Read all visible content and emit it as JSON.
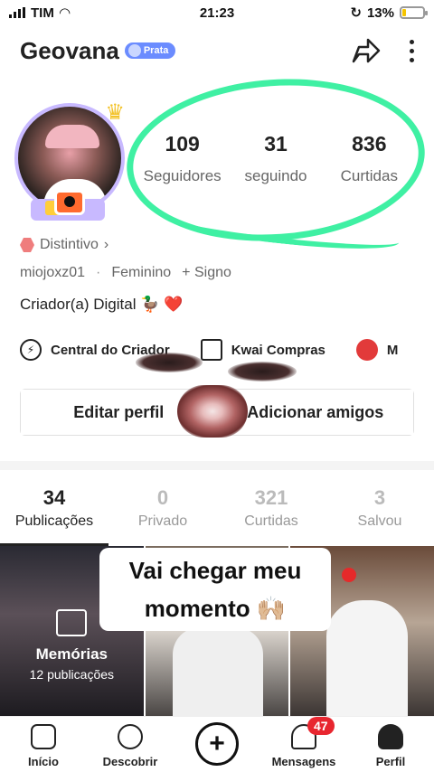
{
  "status_bar": {
    "carrier": "TIM",
    "time": "21:23",
    "battery": "13%"
  },
  "header": {
    "username": "Geovana",
    "badge": "Prata"
  },
  "stats": [
    {
      "value": "109",
      "label": "Seguidores"
    },
    {
      "value": "31",
      "label": "seguindo"
    },
    {
      "value": "836",
      "label": "Curtidas"
    }
  ],
  "profile": {
    "distintivo": "Distintivo",
    "handle": "miojoxz01",
    "gender": "Feminino",
    "sign": "+ Signo",
    "bio": "Criador(a) Digital 🦆",
    "bio_heart": "❤️"
  },
  "tools": [
    {
      "label": "Central do Criador",
      "icon": "lightning-icon"
    },
    {
      "label": "Kwai Compras",
      "icon": "shopping-bag-icon"
    },
    {
      "label": "M",
      "icon": "red-app-icon"
    }
  ],
  "actions": {
    "edit": "Editar perfil",
    "add_friends": "Adicionar amigos"
  },
  "tabs": [
    {
      "count": "34",
      "label": "Publicações",
      "active": true
    },
    {
      "count": "0",
      "label": "Privado",
      "active": false
    },
    {
      "count": "321",
      "label": "Curtidas",
      "active": false
    },
    {
      "count": "3",
      "label": "Salvou",
      "active": false
    }
  ],
  "grid": {
    "memories_title": "Memórias",
    "memories_count": "12 publicações"
  },
  "overlay_caption": {
    "line1": "Vai chegar meu",
    "line2": "momento 🙌🏼"
  },
  "nav": [
    {
      "label": "Início",
      "icon": "home-icon"
    },
    {
      "label": "Descobrir",
      "icon": "compass-icon"
    },
    {
      "label": "",
      "icon": "plus-icon"
    },
    {
      "label": "Mensagens",
      "icon": "bell-icon",
      "badge": "47"
    },
    {
      "label": "Perfil",
      "icon": "person-icon"
    }
  ],
  "colors": {
    "highlight_green": "#3ff0a3",
    "badge_blue": "#6b8cff",
    "notif_red": "#e8262f"
  }
}
